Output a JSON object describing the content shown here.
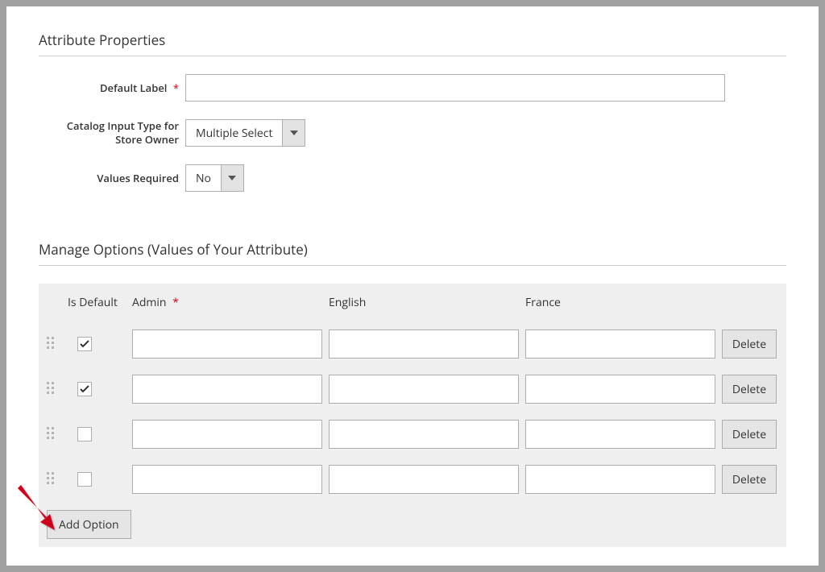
{
  "sections": {
    "attr_props_title": "Attribute Properties",
    "manage_options_title": "Manage Options (Values of Your Attribute)"
  },
  "form": {
    "default_label": {
      "label": "Default Label",
      "value": ""
    },
    "catalog_input_type": {
      "label": "Catalog Input Type for Store Owner",
      "value": "Multiple Select"
    },
    "values_required": {
      "label": "Values Required",
      "value": "No"
    }
  },
  "options": {
    "headers": {
      "is_default": "Is Default",
      "admin": "Admin",
      "english": "English",
      "france": "France"
    },
    "rows": [
      {
        "is_default": true,
        "admin": "",
        "english": "",
        "france": ""
      },
      {
        "is_default": true,
        "admin": "",
        "english": "",
        "france": ""
      },
      {
        "is_default": false,
        "admin": "",
        "english": "",
        "france": ""
      },
      {
        "is_default": false,
        "admin": "",
        "english": "",
        "france": ""
      }
    ],
    "delete_label": "Delete",
    "add_option_label": "Add Option"
  },
  "required_marker": "*"
}
